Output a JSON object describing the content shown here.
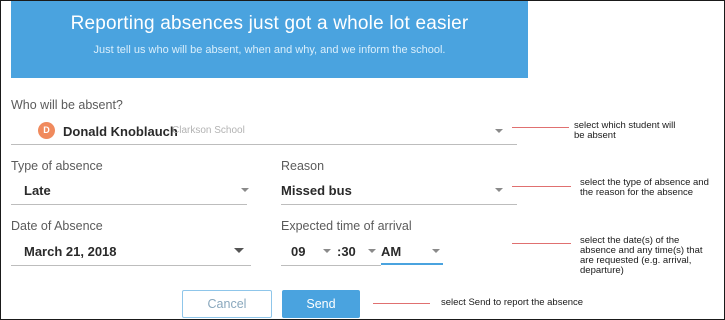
{
  "banner": {
    "title": "Reporting absences just got a whole lot easier",
    "subtitle": "Just tell us who will be absent, when and why, and we inform the school."
  },
  "form": {
    "who": {
      "label": "Who will be absent?",
      "avatar_initial": "D",
      "student_name": "Donald Knoblauch",
      "school": "Clarkson School"
    },
    "type": {
      "label": "Type of absence",
      "value": "Late"
    },
    "reason": {
      "label": "Reason",
      "value": "Missed bus"
    },
    "date": {
      "label": "Date of Absence",
      "value": "March 21, 2018"
    },
    "arrival": {
      "label": "Expected time of arrival",
      "hour": "09",
      "minute": ":30",
      "ampm": "AM"
    },
    "cancel_label": "Cancel",
    "send_label": "Send"
  },
  "annotations": {
    "student": "select which student will be absent",
    "reason": "select the type of absence and the reason for the absence",
    "date": "select the date(s) of the absence and any time(s) that are requested (e.g. arrival, departure)",
    "send": "select Send to report the absence"
  },
  "colors": {
    "accent": "#4aa3df",
    "avatar": "#f08a5d",
    "annotation_line": "#e07070"
  }
}
